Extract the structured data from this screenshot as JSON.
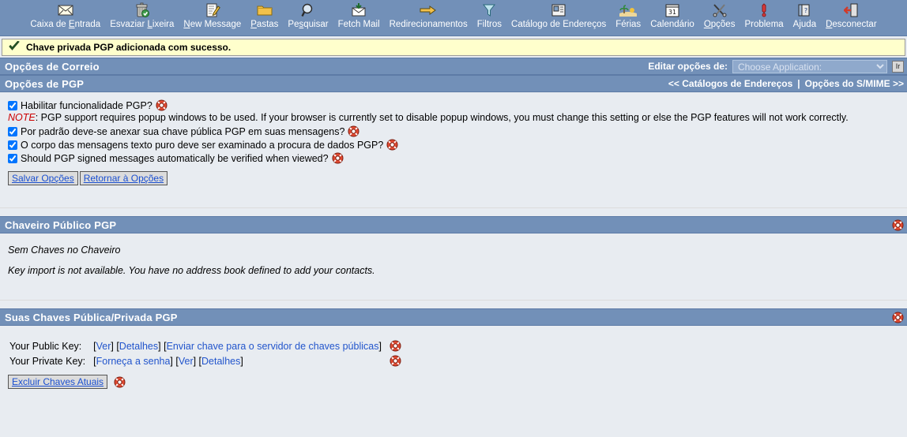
{
  "toolbar": {
    "items": [
      {
        "label": "Caixa de Entrada",
        "icon": "envelope-icon",
        "accesskey": "E"
      },
      {
        "label": "Esvaziar Lixeira",
        "icon": "trash-icon",
        "accesskey": "L"
      },
      {
        "label": "New Message",
        "icon": "compose-icon",
        "accesskey": "N"
      },
      {
        "label": "Pastas",
        "icon": "folder-icon",
        "accesskey": "P"
      },
      {
        "label": "Pesquisar",
        "icon": "magnifier-icon",
        "accesskey": "s"
      },
      {
        "label": "Fetch Mail",
        "icon": "fetchmail-icon",
        "accesskey": ""
      },
      {
        "label": "Redirecionamentos",
        "icon": "arrow-right-icon",
        "accesskey": ""
      },
      {
        "label": "Filtros",
        "icon": "funnel-icon",
        "accesskey": ""
      },
      {
        "label": "Catálogo de Endereços",
        "icon": "addressbook-icon",
        "accesskey": ""
      },
      {
        "label": "Férias",
        "icon": "palm-beach-icon",
        "accesskey": ""
      },
      {
        "label": "Calendário",
        "icon": "calendar-icon",
        "accesskey": ""
      },
      {
        "label": "Opções",
        "icon": "tools-icon",
        "accesskey": "O"
      },
      {
        "label": "Problema",
        "icon": "exclamation-icon",
        "accesskey": ""
      },
      {
        "label": "Ajuda",
        "icon": "help-book-icon",
        "accesskey": ""
      },
      {
        "label": "Desconectar",
        "icon": "logout-icon",
        "accesskey": "D"
      }
    ]
  },
  "notification": {
    "icon": "checkmark-icon",
    "text": "Chave privada PGP adicionada com sucesso."
  },
  "mail_options": {
    "title": "Opções de Correio",
    "edit_label": "Editar opções de:",
    "select_value": "Choose Application:",
    "go_button": "Ir"
  },
  "pgp_options": {
    "title": "Opções de PGP",
    "nav_prev": "<< Catálogos de Endereços",
    "nav_sep": "|",
    "nav_next": "Opções do S/MIME >>",
    "checkboxes": [
      {
        "label": "Habilitar funcionalidade PGP?",
        "checked": true,
        "help": "help-icon"
      },
      {
        "label": "Por padrão deve-se anexar sua chave pública PGP em suas mensagens?",
        "checked": true,
        "help": "help-icon"
      },
      {
        "label": "O corpo das mensagens texto puro deve ser examinado a procura de dados PGP?",
        "checked": true,
        "help": "help-icon"
      },
      {
        "label": "Should PGP signed messages automatically be verified when viewed?",
        "checked": true,
        "help": "help-icon"
      }
    ],
    "note_keyword": "NOTE",
    "note_text": ": PGP support requires popup windows to be used. If your browser is currently set to disable popup windows, you must change this setting or else the PGP features will not work correctly.",
    "save_button": "Salvar Opções",
    "return_button": "Retornar à Opções"
  },
  "public_keyring": {
    "title": "Chaveiro Público PGP",
    "help": "help-icon",
    "empty_text": "Sem Chaves no Chaveiro",
    "import_text": "Key import is not available. You have no address book defined to add your contacts."
  },
  "your_keys": {
    "title": "Suas Chaves Pública/Privada PGP",
    "help": "help-icon",
    "public_label": "Your Public Key:",
    "public_links": [
      "Ver",
      "Detalhes",
      "Enviar chave para o servidor de chaves públicas"
    ],
    "private_label": "Your Private Key:",
    "private_links": [
      "Forneça a senha",
      "Ver",
      "Detalhes"
    ],
    "delete_button": "Excluir Chaves Atuais"
  },
  "colors": {
    "header_bar": "#7290b8",
    "page_bg": "#e8ecf1",
    "notify_bg": "#ffffcc",
    "link": "#2255cc",
    "note": "#cc0000"
  }
}
